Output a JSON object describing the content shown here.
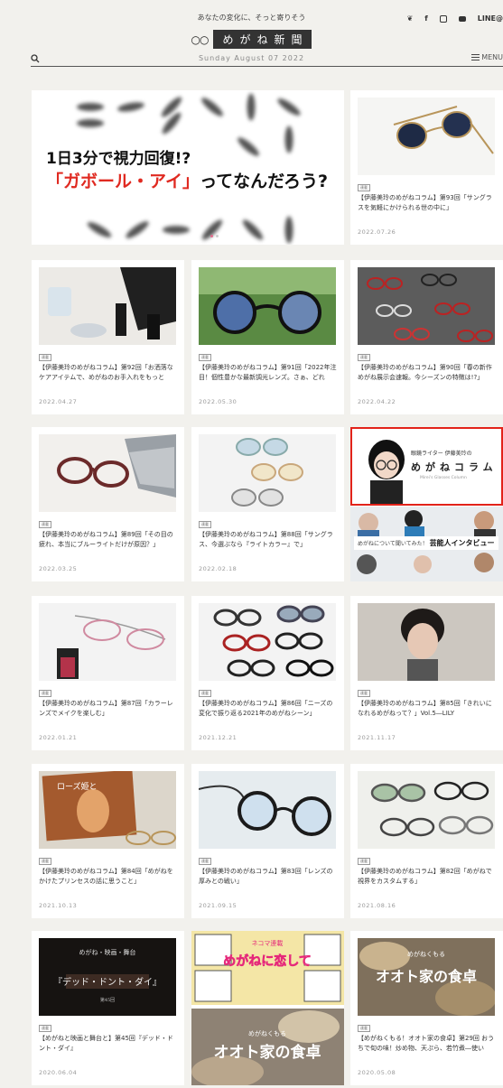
{
  "header": {
    "tagline": "あなたの変化に、そっと寄りそう",
    "logo_text": "めがね新聞",
    "date": "Sunday August 07 2022",
    "menu_label": "MENU",
    "social": {
      "line": "LINE@"
    }
  },
  "hero": {
    "line1": "1日3分で視力回復!?",
    "line2_red": "「ガボール・アイ」",
    "line2_rest": "ってなんだろう?"
  },
  "cards": [
    {
      "tag": "連載",
      "title": "【伊藤美玲のめがねコラム】第93回「サングラスを気軽にかけられる世の中に」",
      "date": "2022.07.26"
    },
    {
      "tag": "連載",
      "title": "【伊藤美玲のめがねコラム】第92回「お洒落なケアアイテムで、めがねのお手入れをもっと",
      "date": "2022.04.27"
    },
    {
      "tag": "連載",
      "title": "【伊藤美玲のめがねコラム】第91回「2022年注目！個性豊かな最新調光レンズ。さぁ、どれ",
      "date": "2022.05.30"
    },
    {
      "tag": "連載",
      "title": "【伊藤美玲のめがねコラム】第90回「春の新作めがね展示会速報。今シーズンの特徴は!?」",
      "date": "2022.04.22"
    },
    {
      "tag": "連載",
      "title": "【伊藤美玲のめがねコラム】第89回「その目の疲れ、本当にブルーライトだけが原因？」",
      "date": "2022.03.25"
    },
    {
      "tag": "連載",
      "title": "【伊藤美玲のめがねコラム】第88回「サングラス、今選ぶなら『ライトカラー』で」",
      "date": "2022.02.18"
    },
    {
      "tag": "連載",
      "title": "【伊藤美玲のめがねコラム】第87回「カラーレンズでメイクを楽しむ」",
      "date": "2022.01.21"
    },
    {
      "tag": "連載",
      "title": "【伊藤美玲のめがねコラム】第86回「ニーズの変化で振り返る2021年のめがねシーン」",
      "date": "2021.12.21"
    },
    {
      "tag": "連載",
      "title": "【伊藤美玲のめがねコラム】第85回「きれいになれるめがねって？」Vol.5―LILY",
      "date": "2021.11.17"
    },
    {
      "tag": "連載",
      "title": "【伊藤美玲のめがねコラム】第84回「めがねをかけたプリンセスの話に思うこと」",
      "date": "2021.10.13"
    },
    {
      "tag": "連載",
      "title": "【伊藤美玲のめがねコラム】第83回「レンズの厚みとの戦い」",
      "date": "2021.09.15"
    },
    {
      "tag": "連載",
      "title": "【伊藤美玲のめがねコラム】第82回「めがねで視界をカスタムする」",
      "date": "2021.08.16"
    },
    {
      "tag": "連載",
      "title": "【めがねと映画と舞台と】第45回『デッド・ドント・ダイ』",
      "date": "2020.06.04"
    },
    {
      "tag": "連載",
      "title": "【めがねくもる！オオト家の食卓】第29回 おうちで旬の味！炒め物、天ぷら、若竹煮―使い",
      "date": "2020.05.08"
    }
  ],
  "promo": {
    "sub": "眼鏡ライター 伊藤美玲の",
    "big": "めがねコラム",
    "small": "Mirei's Glasses Column",
    "interview_small": "めがねについて聞いてみた！",
    "interview_big": "芸能人インタビュー"
  },
  "card13_thumb": {
    "top": "めがね・映画・舞台",
    "title": "『デッド・ドント・ダイ』",
    "sub": "第45回"
  },
  "manga_banner": {
    "top": "ネコマ連載",
    "big": "めがねに恋して"
  },
  "ooto_banner": {
    "top": "めがねくもる",
    "big": "オオト家の食卓"
  },
  "colors": {
    "accent_red": "#e2231a",
    "bg": "#f2f1ed"
  }
}
